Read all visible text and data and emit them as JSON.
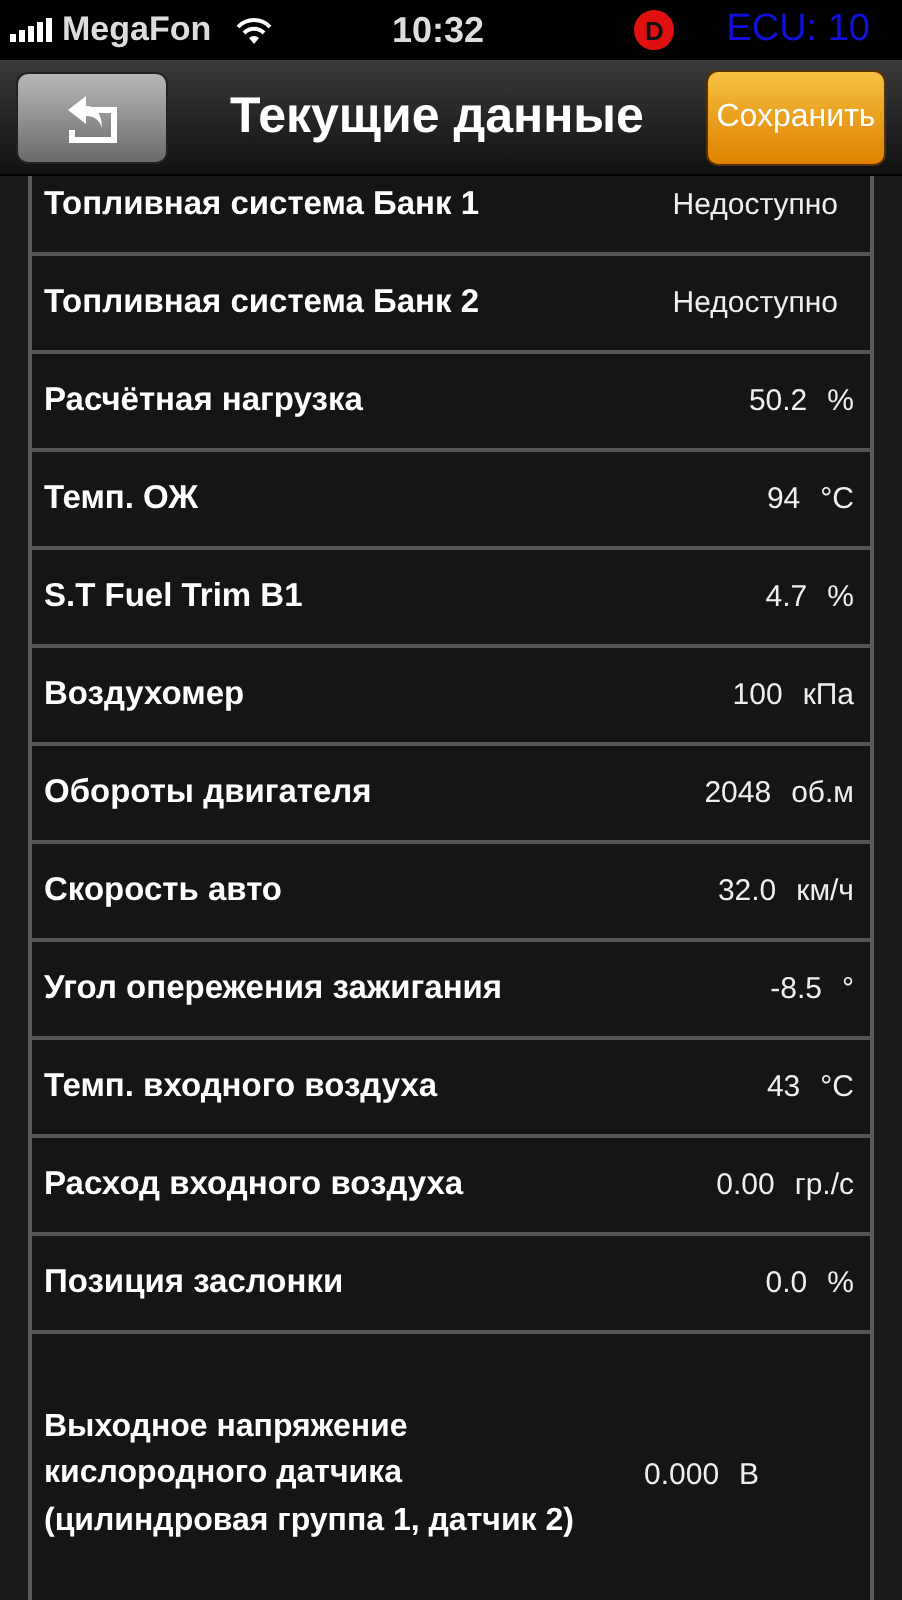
{
  "status_bar": {
    "carrier": "MegaFon",
    "time": "10:32",
    "badge": "D",
    "ecu": "ECU: 10"
  },
  "nav_bar": {
    "title": "Текущие данные",
    "save_button": "Сохранить"
  },
  "rows": [
    {
      "label": "Топливная система Банк 1",
      "value": "Недоступно"
    },
    {
      "label": "Топливная система Банк 2",
      "value": "Недоступно"
    },
    {
      "label": "Расчётная нагрузка",
      "value": "50.2",
      "unit": "%"
    },
    {
      "label": "Темп. ОЖ",
      "value": "94",
      "unit": "°C"
    },
    {
      "label": "S.T Fuel Trim B1",
      "value": "4.7",
      "unit": "%"
    },
    {
      "label": "Воздухомер",
      "value": "100",
      "unit": "кПа"
    },
    {
      "label": "Обороты двигателя",
      "value": "2048",
      "unit": "об.м"
    },
    {
      "label": "Скорость авто",
      "value": "32.0",
      "unit": "км/ч"
    },
    {
      "label": "Угол опережения зажигания",
      "value": "-8.5",
      "unit": "°"
    },
    {
      "label": "Темп. входного воздуха",
      "value": "43",
      "unit": "°C"
    },
    {
      "label": "Расход входного воздуха",
      "value": "0.00",
      "unit": "гр./с"
    },
    {
      "label": "Позиция заслонки",
      "value": "0.0",
      "unit": "%"
    },
    {
      "label": "Выходное напряжение кислородного датчика (цилиндровая группа 1, датчик 2)",
      "value": "0.000",
      "unit": "В",
      "kind": "tall"
    }
  ]
}
